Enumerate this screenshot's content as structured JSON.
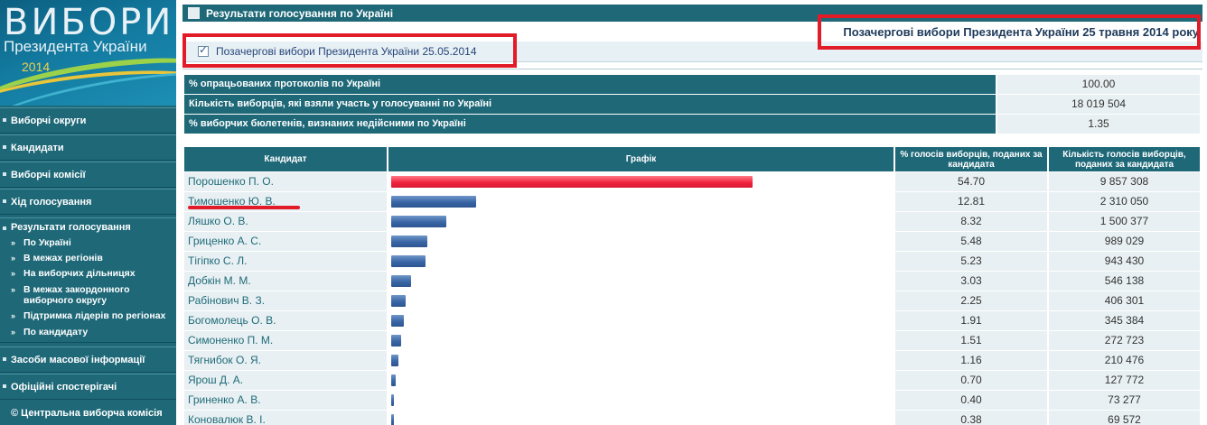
{
  "logo": {
    "line1": "ВИБОРИ",
    "line2": "Президента України",
    "year": "2014"
  },
  "sidebar": {
    "items": [
      {
        "label": "Виборчі округи"
      },
      {
        "label": "Кандидати"
      },
      {
        "label": "Виборчі комісії"
      },
      {
        "label": "Хід голосування"
      }
    ],
    "results": {
      "label": "Результати голосування",
      "sub_items": [
        {
          "label": "По Україні"
        },
        {
          "label": "В межах регіонів"
        },
        {
          "label": "На виборчих дільницях"
        },
        {
          "label": "В межах закордонного виборчого округу"
        },
        {
          "label": "Підтримка лідерів по регіонах"
        },
        {
          "label": "По кандидату"
        }
      ]
    },
    "bottom_items": [
      {
        "label": "Засоби масової інформації"
      },
      {
        "label": "Офіційні спостерігачі"
      }
    ],
    "copyright": "© Центральна виборча комісія"
  },
  "header": {
    "title": "Результати голосування по Україні",
    "election_title": "Позачергові вибори Президента України 25 травня 2014 року"
  },
  "filter": {
    "label": "Позачергові вибори Президента України 25.05.2014",
    "checked": true
  },
  "summary": [
    {
      "label": "% опрацьованих протоколів по Україні",
      "value": "100.00"
    },
    {
      "label": "Кількість виборців, які взяли участь у голосуванні по Україні",
      "value": "18 019 504"
    },
    {
      "label": "% виборчих бюлетенів, визнаних недійсними по Україні",
      "value": "1.35"
    }
  ],
  "table_headers": {
    "candidate": "Кандидат",
    "graph": "Графік",
    "percent": "% голосів виборців, поданих за кандидата",
    "count": "Кількість голосів виборців, поданих за кандидата"
  },
  "candidates": [
    {
      "name": "Порошенко П. О.",
      "percent": "54.70",
      "votes": "9 857 308",
      "bar_color": "red"
    },
    {
      "name": "Тимошенко Ю. В.",
      "percent": "12.81",
      "votes": "2 310 050",
      "bar_color": "blue"
    },
    {
      "name": "Ляшко О. В.",
      "percent": "8.32",
      "votes": "1 500 377",
      "bar_color": "blue"
    },
    {
      "name": "Гриценко А. С.",
      "percent": "5.48",
      "votes": "989 029",
      "bar_color": "blue"
    },
    {
      "name": "Тігіпко С. Л.",
      "percent": "5.23",
      "votes": "943 430",
      "bar_color": "blue"
    },
    {
      "name": "Добкін М. М.",
      "percent": "3.03",
      "votes": "546 138",
      "bar_color": "blue"
    },
    {
      "name": "Рабінович В. З.",
      "percent": "2.25",
      "votes": "406 301",
      "bar_color": "blue"
    },
    {
      "name": "Богомолець О. В.",
      "percent": "1.91",
      "votes": "345 384",
      "bar_color": "blue"
    },
    {
      "name": "Симоненко П. М.",
      "percent": "1.51",
      "votes": "272 723",
      "bar_color": "blue"
    },
    {
      "name": "Тягнибок О. Я.",
      "percent": "1.16",
      "votes": "210 476",
      "bar_color": "blue"
    },
    {
      "name": "Ярош Д. А.",
      "percent": "0.70",
      "votes": "127 772",
      "bar_color": "blue"
    },
    {
      "name": "Гриненко А. В.",
      "percent": "0.40",
      "votes": "73 277",
      "bar_color": "blue"
    },
    {
      "name": "Коновалюк В. І.",
      "percent": "0.38",
      "votes": "69 572",
      "bar_color": "blue"
    }
  ],
  "colors": {
    "primary": "#1e6878",
    "bar_highlight": "#f0243e",
    "bar_default": "#3a66a6",
    "annotation": "#e21b28"
  }
}
